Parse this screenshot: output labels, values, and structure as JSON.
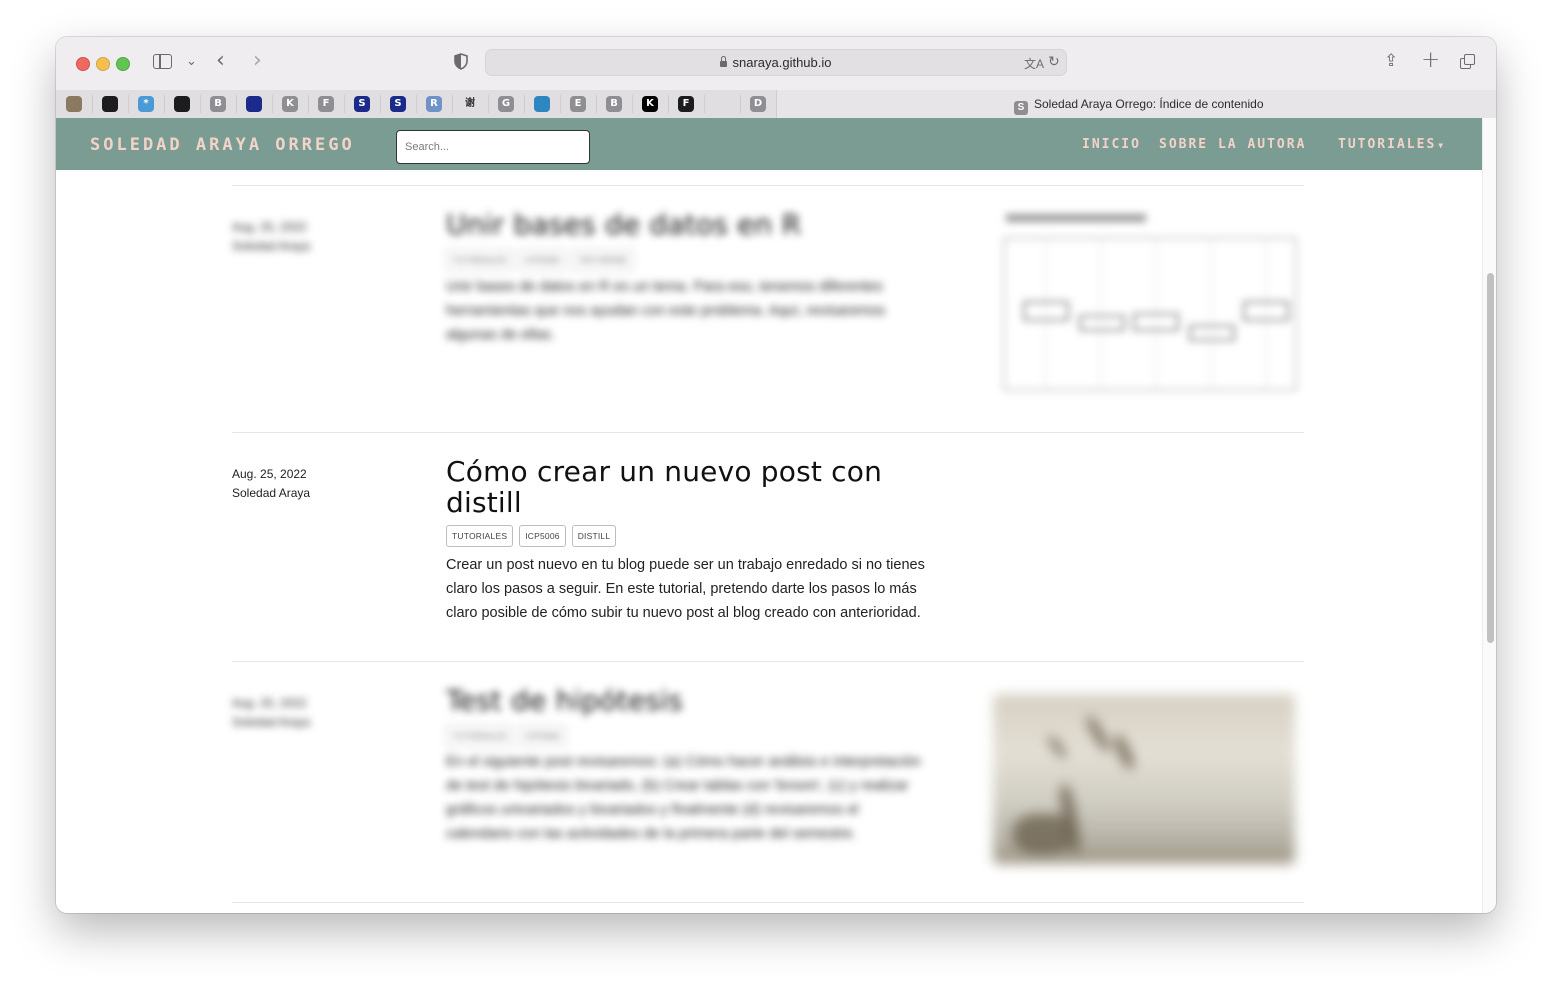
{
  "browser": {
    "url": "snaraya.github.io",
    "tab_title": "Soledad Araya Orrego: Índice de contenido",
    "tab_favicon_letter": "S",
    "favorites": [
      {
        "label": "",
        "color": "#8a7a62"
      },
      {
        "label": "",
        "color": "#1c1c1e"
      },
      {
        "label": "*",
        "color": "#4a9ad6"
      },
      {
        "label": "",
        "color": "#1c1c1e"
      },
      {
        "label": "B",
        "color": "#8e8e93"
      },
      {
        "label": "",
        "color": "#1a2b8c"
      },
      {
        "label": "K",
        "color": "#8e8e93"
      },
      {
        "label": "F",
        "color": "#8e8e93"
      },
      {
        "label": "S",
        "color": "#1a2b8c"
      },
      {
        "label": "S",
        "color": "#1a2b8c"
      },
      {
        "label": "R",
        "color": "#6f93c8"
      },
      {
        "label": "谢",
        "color": "#e0dee1"
      },
      {
        "label": "G",
        "color": "#8e8e93"
      },
      {
        "label": "",
        "color": "#2e86c1"
      },
      {
        "label": "E",
        "color": "#8e8e93"
      },
      {
        "label": "B",
        "color": "#8e8e93"
      },
      {
        "label": "K",
        "color": "#000000"
      },
      {
        "label": "F",
        "color": "#1c1c1e"
      },
      {
        "label": "",
        "color": "#e0dee1"
      },
      {
        "label": "D",
        "color": "#8e8e93"
      }
    ]
  },
  "site": {
    "title": "SOLEDAD ARAYA ORREGO",
    "search_placeholder": "Search...",
    "nav": {
      "inicio": "INICIO",
      "sobre": "SOBRE LA AUTORA",
      "tutoriales": "TUTORIALES",
      "caret": "▼"
    }
  },
  "posts": [
    {
      "date": "Aug. 25, 2022",
      "author": "Soledad Araya",
      "title": "Unir bases de datos en R",
      "tags": [
        "TUTORIALES",
        "ICP5006",
        "TIDYVERSE"
      ],
      "description": "Unir bases de datos en R es un tema. Para eso, tenemos diferentes herramientas que nos ayudan con este problema. Aquí, revisaremos algunas de ellas.",
      "blurred": true
    },
    {
      "date": "Aug. 25, 2022",
      "author": "Soledad Araya",
      "title": "Cómo crear un nuevo post con distill",
      "tags": [
        "TUTORIALES",
        "ICP5006",
        "DISTILL"
      ],
      "description": "Crear un post nuevo en tu blog puede ser un trabajo enredado si no tienes claro los pasos a seguir. En este tutorial, pretendo darte los pasos lo más claro posible de cómo subir tu nuevo post al blog creado con anterioridad.",
      "blurred": false
    },
    {
      "date": "Aug. 25, 2022",
      "author": "Soledad Araya",
      "title": "Test de hipótesis",
      "tags": [
        "TUTORIALES",
        "ICP5006"
      ],
      "description": "En el siguiente post revisaremos: (a) Cómo hacer análisis e interpretación de test de hipótesis bivariado, (b) Crear tablas con 'broom', (c) y realizar gráficos univariados y bivariados y finalmente (d) revisaremos el calendario con las actividades de la primera parte del semestre.",
      "blurred": true
    }
  ],
  "colors": {
    "nav_bg": "#7b9c93",
    "nav_text": "#f2d3c9"
  }
}
